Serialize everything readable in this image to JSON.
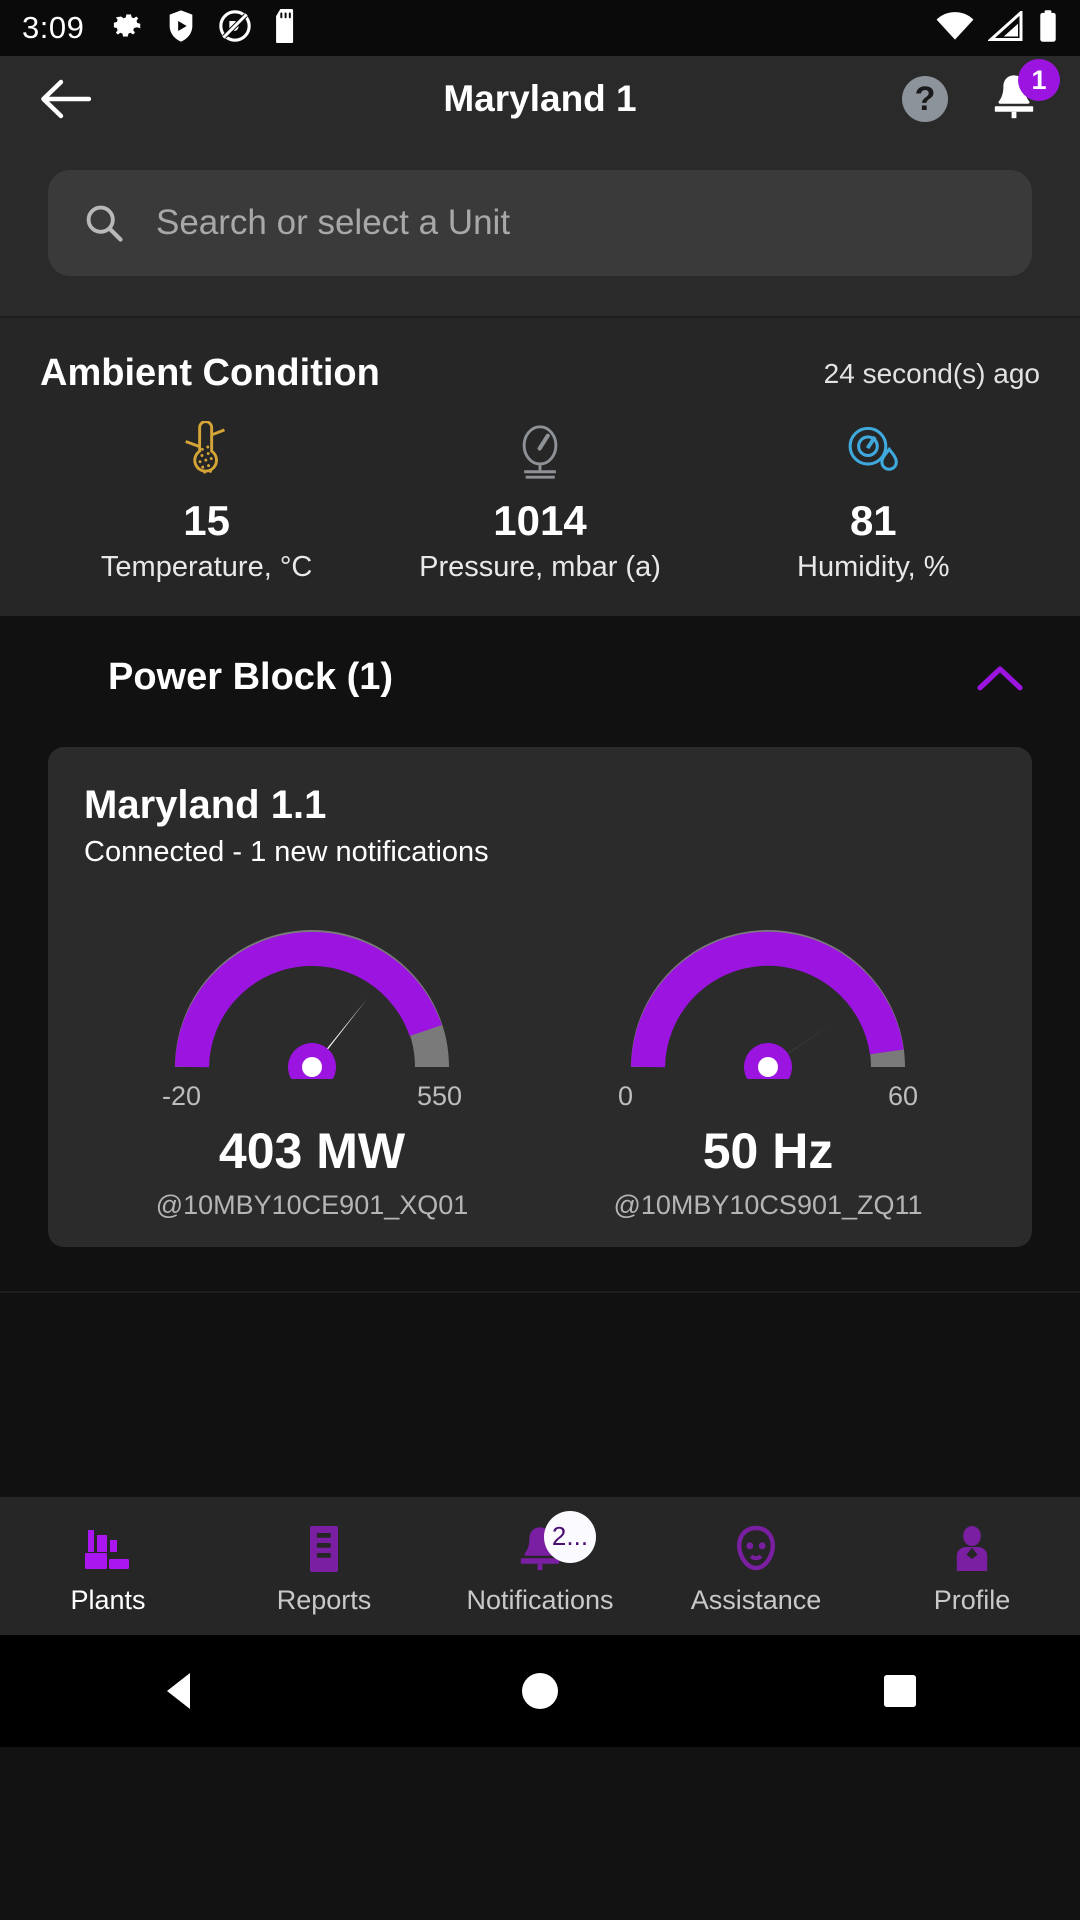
{
  "statusbar": {
    "time": "3:09",
    "left_icons": [
      "gear-icon",
      "shield-play-icon",
      "do-not-disturb-icon",
      "sd-card-icon"
    ],
    "right_icons": [
      "wifi-icon",
      "cellular-signal-icon",
      "battery-icon"
    ]
  },
  "appbar": {
    "back_icon": "arrow-left-icon",
    "title": "Maryland 1",
    "help_label": "?",
    "notification_badge": "1"
  },
  "search": {
    "placeholder": "Search or select a Unit",
    "value": "",
    "icon": "search-icon"
  },
  "ambient": {
    "title": "Ambient Condition",
    "updated": "24 second(s) ago",
    "metrics": [
      {
        "icon": "thermometer-icon",
        "value": "15",
        "label": "Temperature, °C",
        "color": "#d4a437"
      },
      {
        "icon": "pressure-gauge-icon",
        "value": "1014",
        "label": "Pressure, mbar (a)",
        "color": "#8e9296"
      },
      {
        "icon": "humidity-icon",
        "value": "81",
        "label": "Humidity, %",
        "color": "#3fa9dd"
      }
    ]
  },
  "power_block": {
    "title": "Power Block (1)",
    "collapse_icon": "chevron-up-icon",
    "expanded": true,
    "unit": {
      "name": "Maryland 1.1",
      "status": "Connected",
      "status_separator": " - ",
      "notifications_text": "1 new notifications"
    }
  },
  "chart_data": [
    {
      "type": "gauge",
      "title": "403 MW",
      "tag": "@10MBY10CE901_XQ01",
      "value": 403,
      "unit": "MW",
      "min": -20,
      "max": 550,
      "min_label": "-20",
      "max_label": "550",
      "fill_fraction": 0.742,
      "arc_color": "#9c14e0",
      "track_color": "#7a7a7a",
      "needle_color": "#ffffff",
      "hub_color": "#9c14e0"
    },
    {
      "type": "gauge",
      "title": "50 Hz",
      "tag": "@10MBY10CS901_ZQ11",
      "value": 50,
      "unit": "Hz",
      "min": 0,
      "max": 60,
      "min_label": "0",
      "max_label": "60",
      "fill_fraction": 0.833,
      "arc_color": "#9c14e0",
      "track_color": "#7a7a7a",
      "needle_color": "#ffffff",
      "hub_color": "#9c14e0"
    }
  ],
  "bottom_nav": {
    "items": [
      {
        "icon": "factory-icon",
        "label": "Plants",
        "active": true,
        "badge": ""
      },
      {
        "icon": "reports-icon",
        "label": "Reports",
        "active": false,
        "badge": ""
      },
      {
        "icon": "bell-icon",
        "label": "Notifications",
        "active": false,
        "badge": "2..."
      },
      {
        "icon": "assistance-face-icon",
        "label": "Assistance",
        "active": false,
        "badge": ""
      },
      {
        "icon": "profile-icon",
        "label": "Profile",
        "active": false,
        "badge": ""
      }
    ]
  },
  "system_nav": {
    "back": "triangle-back-icon",
    "home": "circle-home-icon",
    "recents": "square-recents-icon"
  },
  "colors": {
    "accent": "#9c14e0",
    "nav_icon": "#7b1fa2",
    "nav_icon_active": "#a916ef",
    "page_bg": "#121212",
    "card_bg": "#2b2b2b"
  }
}
